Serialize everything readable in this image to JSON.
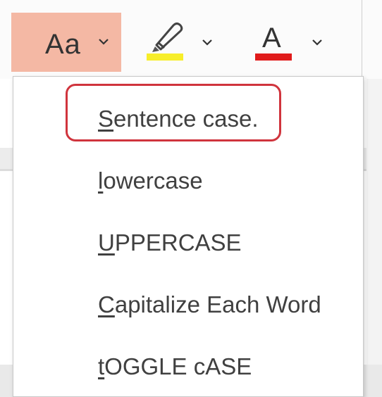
{
  "ribbon": {
    "change_case_button": {
      "label_main": "Aa",
      "icon": "chevron-down-icon"
    },
    "highlight_button": {
      "icon": "highlighter-icon",
      "color": "#f7ee2a"
    },
    "font_color_button": {
      "letter": "A",
      "color": "#e01b1b"
    }
  },
  "menu": {
    "items": [
      {
        "first": "S",
        "rest": "entence case.",
        "highlighted": true
      },
      {
        "first": "l",
        "rest": "owercase"
      },
      {
        "first": "U",
        "rest": "PPERCASE"
      },
      {
        "first": "C",
        "rest": "apitalize Each Word"
      },
      {
        "first": "t",
        "rest": "OGGLE cASE"
      }
    ]
  },
  "colors": {
    "active_button_bg": "#f4b8a4",
    "callout_border": "#d0343d"
  }
}
